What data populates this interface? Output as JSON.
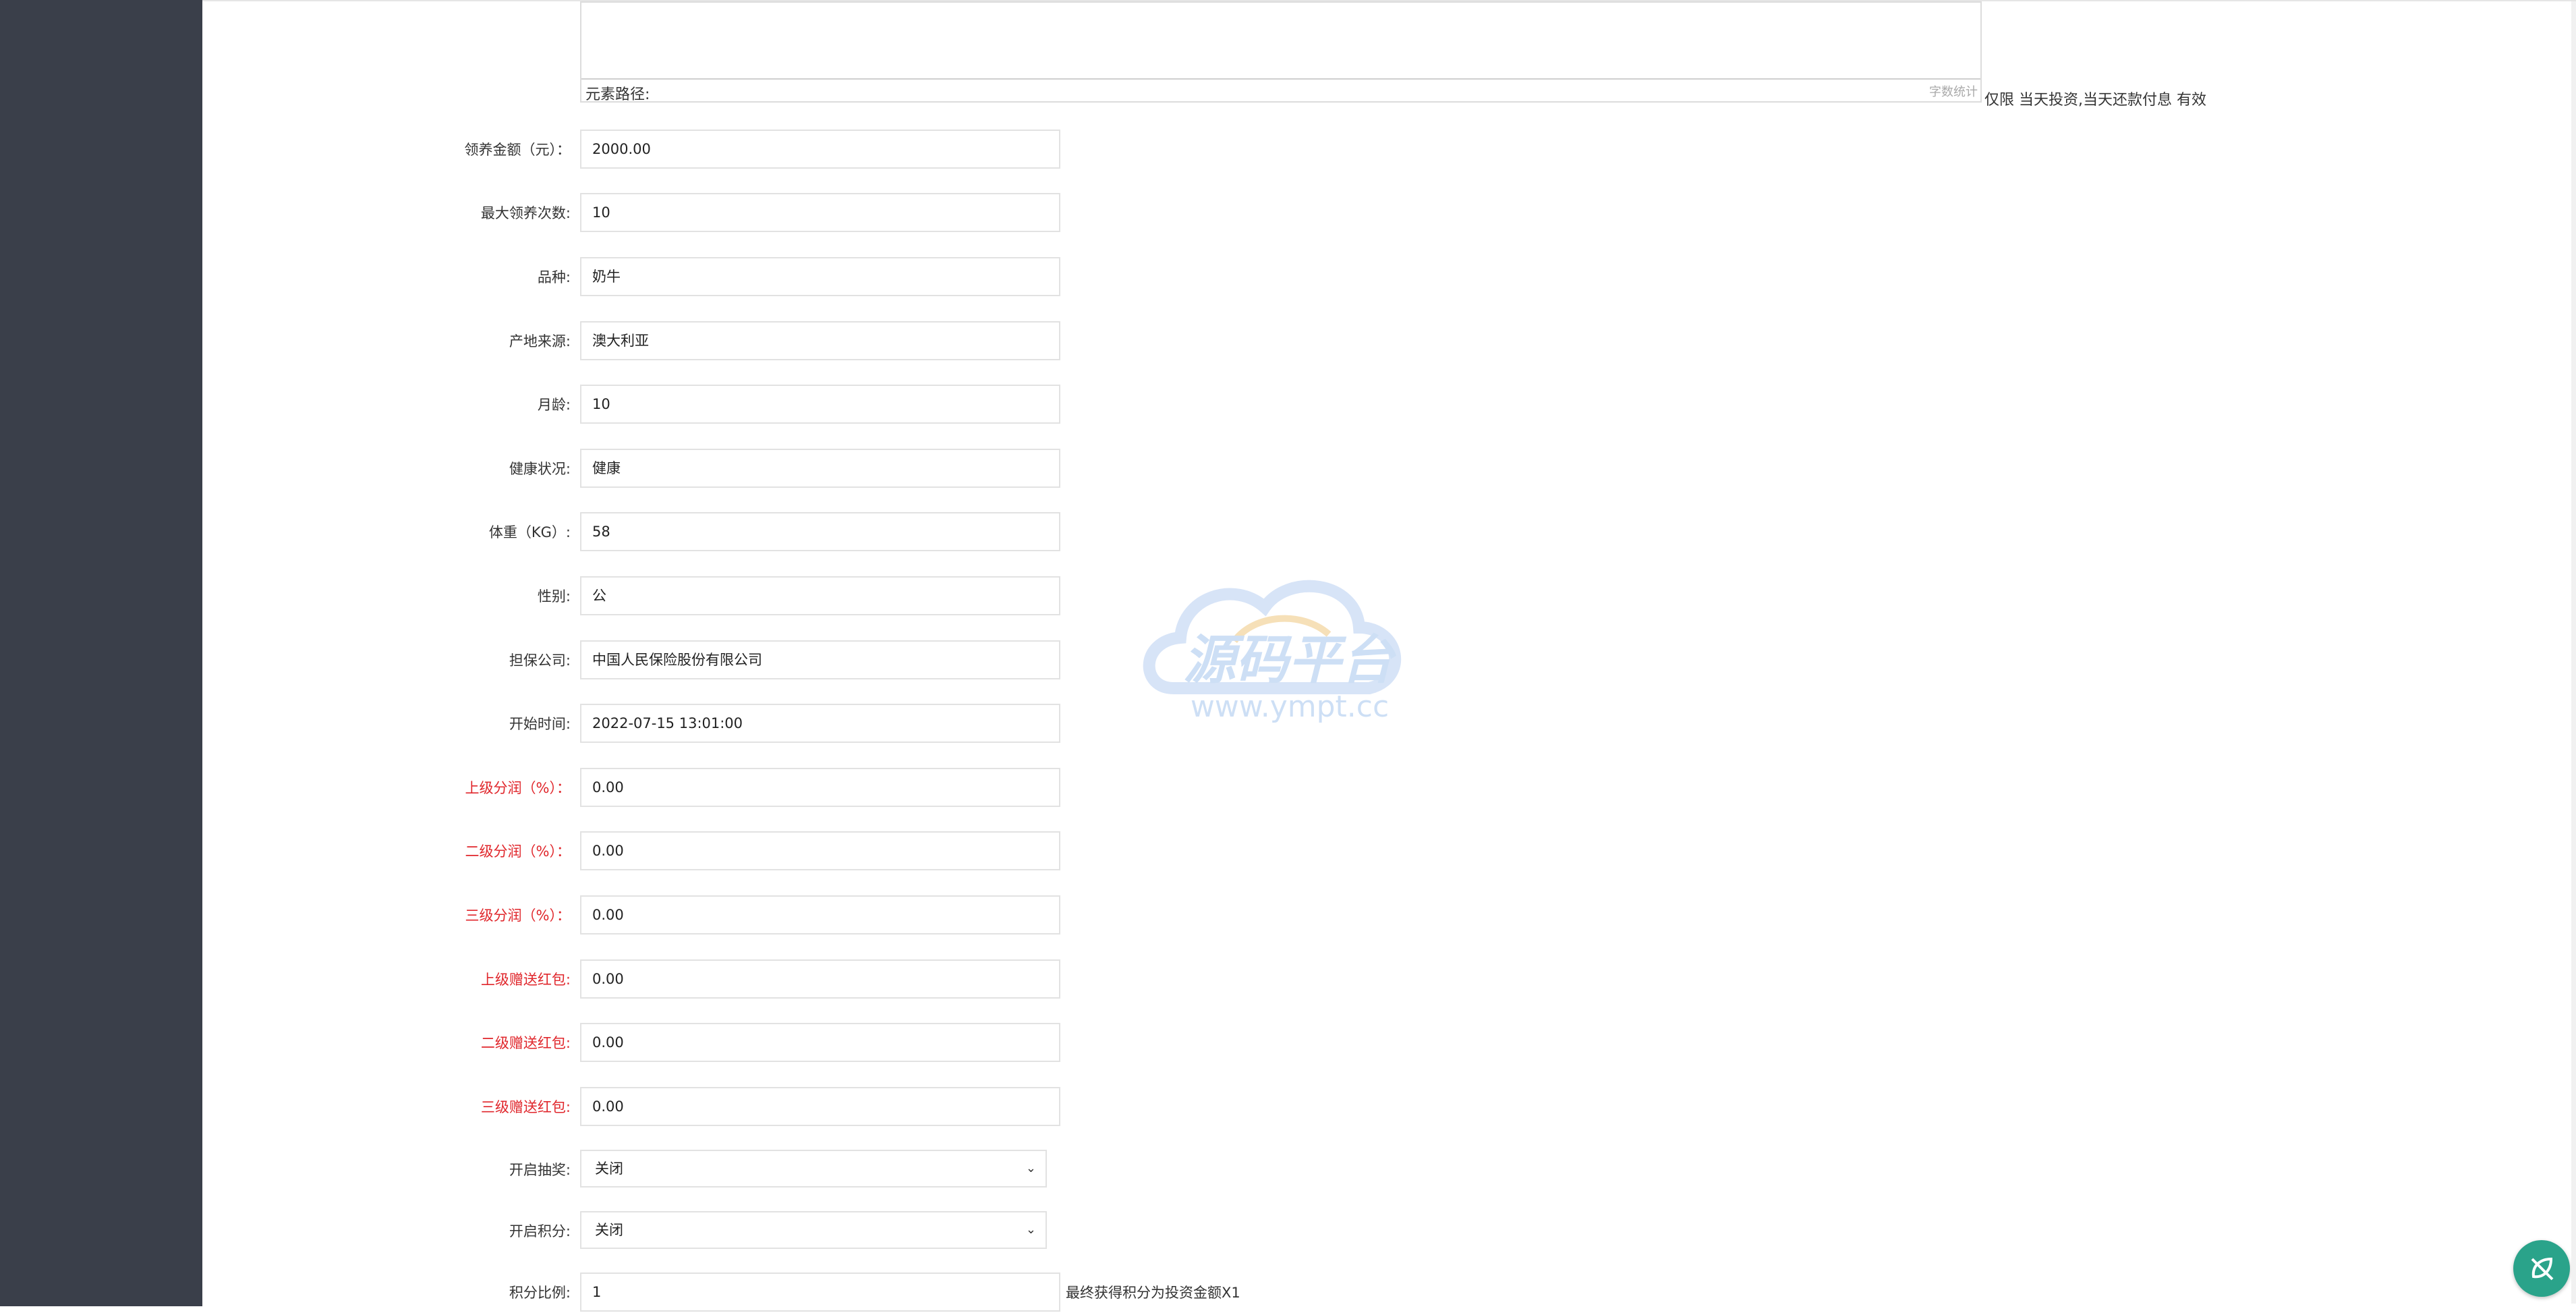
{
  "editor": {
    "path_label": "元素路径:",
    "word_count": "字数统计"
  },
  "top_note": "仅限 当天投资,当天还款付息 有效",
  "fields": [
    {
      "label": "领养金额（元）：",
      "value": "2000.00",
      "red": false
    },
    {
      "label": "最大领养次数:",
      "value": "10",
      "red": false
    },
    {
      "label": "品种:",
      "value": "奶牛",
      "red": false
    },
    {
      "label": "产地来源:",
      "value": "澳大利亚",
      "red": false
    },
    {
      "label": "月龄:",
      "value": "10",
      "red": false
    },
    {
      "label": "健康状况:",
      "value": "健康",
      "red": false
    },
    {
      "label": "体重（KG）:",
      "value": "58",
      "red": false
    },
    {
      "label": "性别:",
      "value": "公",
      "red": false
    },
    {
      "label": "担保公司:",
      "value": "中国人民保险股份有限公司",
      "red": false
    },
    {
      "label": "开始时间:",
      "value": "2022-07-15 13:01:00",
      "red": false
    },
    {
      "label": "上级分润（%）：",
      "value": "0.00",
      "red": true
    },
    {
      "label": "二级分润（%）：",
      "value": "0.00",
      "red": true
    },
    {
      "label": "三级分润（%）：",
      "value": "0.00",
      "red": true
    },
    {
      "label": "上级赠送红包:",
      "value": "0.00",
      "red": true
    },
    {
      "label": "二级赠送红包:",
      "value": "0.00",
      "red": true
    },
    {
      "label": "三级赠送红包:",
      "value": "0.00",
      "red": true
    }
  ],
  "selects": [
    {
      "label": "开启抽奖:",
      "value": "关闭"
    },
    {
      "label": "开启积分:",
      "value": "关闭"
    }
  ],
  "points": {
    "label": "积分比例:",
    "value": "1",
    "suffix": "最终获得积分为投资金额X1"
  },
  "watermark": {
    "title": "源码平台",
    "url": "www.ympt.cc"
  },
  "colors": {
    "sidebar": "#3a3f4a",
    "required_label": "#e0262b",
    "fab": "#2aa38a"
  }
}
